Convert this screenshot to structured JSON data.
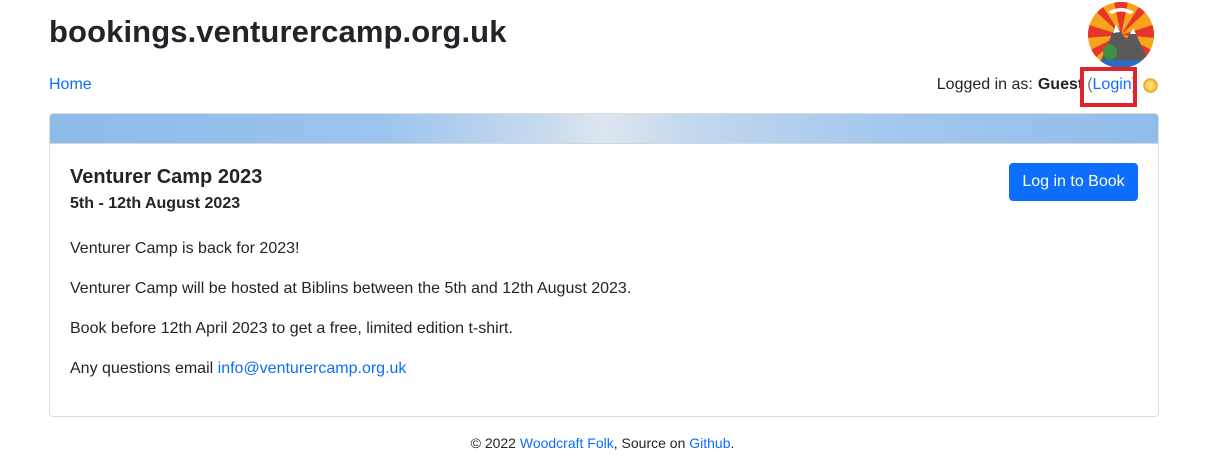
{
  "header": {
    "site_title": "bookings.venturercamp.org.uk"
  },
  "nav": {
    "home": "Home",
    "logged_in_prefix": "Logged in as:",
    "user": "Guest",
    "open_paren": "(",
    "login": "Login",
    "close_paren": ")"
  },
  "event": {
    "title": "Venturer Camp 2023",
    "dates": "5th - 12th August 2023",
    "book_button": "Log in to Book",
    "paragraphs": [
      "Venturer Camp is back for 2023!",
      "Venturer Camp will be hosted at Biblins between the 5th and 12th August 2023.",
      "Book before 12th April 2023 to get a free, limited edition t-shirt."
    ],
    "questions_prefix": "Any questions email ",
    "email": "info@venturercamp.org.uk"
  },
  "footer": {
    "copyright": "© 2022 ",
    "org_link": "Woodcraft Folk",
    "source_text": ", Source on ",
    "github_link": "Github",
    "end": "."
  },
  "colors": {
    "link": "#0d6efd",
    "primary_button": "#0d6efd",
    "highlight": "#e0242b"
  },
  "icons": {
    "logo": "venturer-camp-logo",
    "theme_toggle": "sun-icon"
  }
}
